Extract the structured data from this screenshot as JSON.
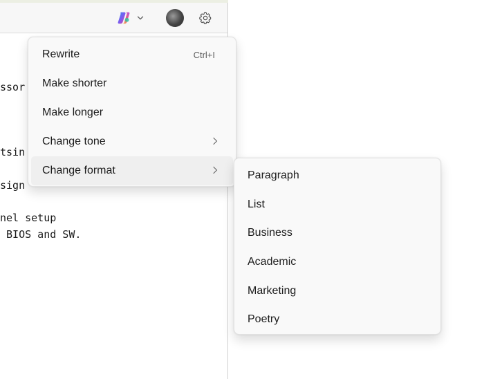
{
  "editor": {
    "lines": [
      "ssor",
      "tsin",
      "sign",
      "nel setup",
      " BIOS and SW."
    ]
  },
  "toolbar": {
    "copilot_icon": "copilot-icon",
    "chevron_icon": "chevron-down-icon",
    "avatar_icon": "avatar",
    "settings_icon": "gear-icon"
  },
  "rewrite_menu": {
    "items": [
      {
        "label": "Rewrite",
        "shortcut": "Ctrl+I"
      },
      {
        "label": "Make shorter"
      },
      {
        "label": "Make longer"
      },
      {
        "label": "Change tone",
        "has_submenu": true
      },
      {
        "label": "Change format",
        "has_submenu": true,
        "active": true
      }
    ]
  },
  "format_submenu": {
    "items": [
      {
        "label": "Paragraph"
      },
      {
        "label": "List"
      },
      {
        "label": "Business"
      },
      {
        "label": "Academic"
      },
      {
        "label": "Marketing"
      },
      {
        "label": "Poetry"
      }
    ]
  },
  "colors": {
    "menu_bg": "#f9f9f9",
    "active_item_bg": "#efefef",
    "text": "#1b1b1b"
  }
}
